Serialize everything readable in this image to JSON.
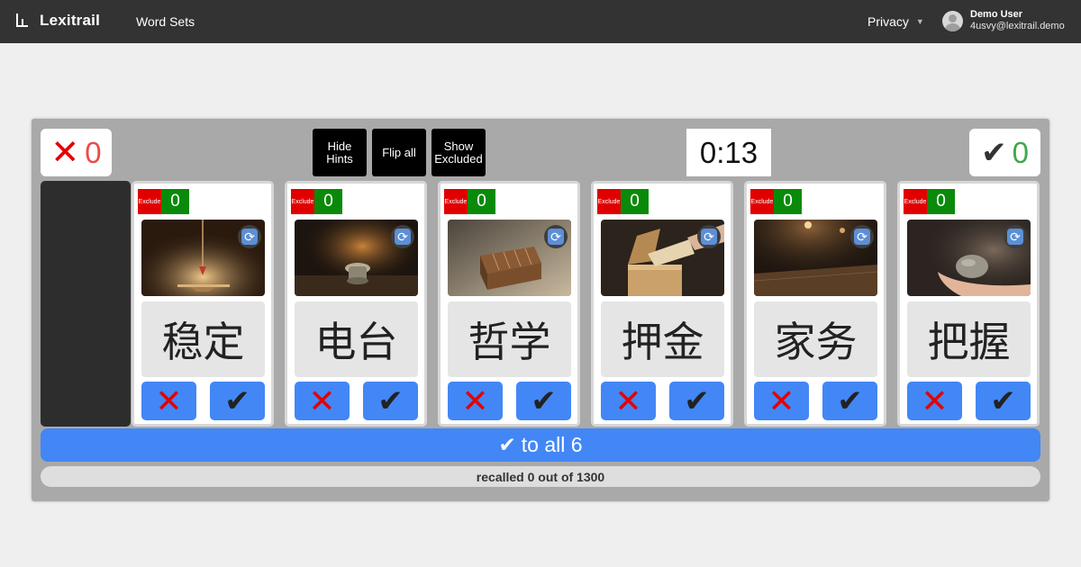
{
  "nav": {
    "brand": "Lexitrail",
    "word_sets": "Word Sets",
    "privacy": "Privacy",
    "caret": "▼",
    "user_name": "Demo User",
    "user_email": "4usvy@lexitrail.demo"
  },
  "scores": {
    "wrong_icon": "✕-icon",
    "wrong_glyph": "❌",
    "wrong_count": "0",
    "right_glyph": "✔",
    "right_count": "0"
  },
  "controls": {
    "hide_hints": "Hide\nHints",
    "flip_all": "Flip all",
    "show_excluded": "Show\nExcluded"
  },
  "timer": "0:13",
  "card_common": {
    "exclude_label": "Exclude",
    "refresh_glyph": "🔄",
    "no_glyph": "❌",
    "yes_glyph": "✔"
  },
  "cards": [
    {
      "word": "稳定",
      "count": "0",
      "image": "balance-scale-image"
    },
    {
      "word": "电台",
      "count": "0",
      "image": "radio-knob-image"
    },
    {
      "word": "哲学",
      "count": "0",
      "image": "bread-loaf-image"
    },
    {
      "word": "押金",
      "count": "0",
      "image": "wooden-box-envelope-image"
    },
    {
      "word": "家务",
      "count": "0",
      "image": "wooden-table-image"
    },
    {
      "word": "把握",
      "count": "0",
      "image": "hand-holding-stone-image"
    }
  ],
  "all_button": {
    "glyph": "✔",
    "label": "to all 6"
  },
  "progress": {
    "text": "recalled 0 out of 1300",
    "recalled": 0,
    "total": 1300
  },
  "colors": {
    "nav_bg": "#333333",
    "panel_bg": "#a9a9a9",
    "accent_blue": "#4287f5",
    "exclude_red": "#e00000",
    "count_green": "#0a8a0a",
    "wrong_red": "#ec4b4b",
    "right_green": "#3fa84b"
  }
}
